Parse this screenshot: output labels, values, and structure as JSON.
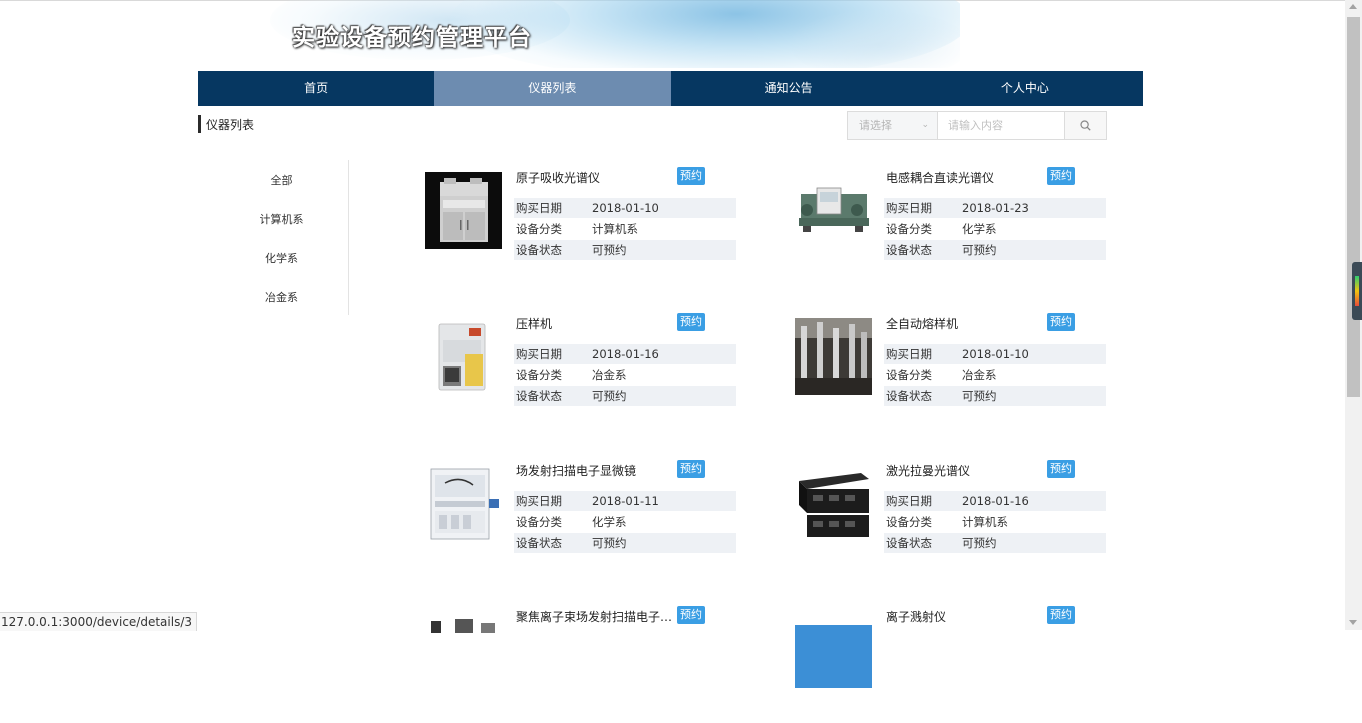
{
  "site_title": "实验设备预约管理平台",
  "nav": [
    {
      "label": "首页",
      "active": false
    },
    {
      "label": "仪器列表",
      "active": true
    },
    {
      "label": "通知公告",
      "active": false
    },
    {
      "label": "个人中心",
      "active": false
    }
  ],
  "section_title": "仪器列表",
  "search": {
    "select_placeholder": "请选择",
    "input_placeholder": "请输入内容"
  },
  "categories": [
    "全部",
    "计算机系",
    "化学系",
    "冶金系"
  ],
  "field_labels": {
    "purchase_date": "购买日期",
    "category": "设备分类",
    "status": "设备状态"
  },
  "book_label": "预约",
  "devices": [
    {
      "name": "原子吸收光谱仪",
      "purchase_date": "2018-01-10",
      "category": "计算机系",
      "status": "可预约"
    },
    {
      "name": "电感耦合直读光谱仪",
      "purchase_date": "2018-01-23",
      "category": "化学系",
      "status": "可预约"
    },
    {
      "name": "压样机",
      "purchase_date": "2018-01-16",
      "category": "冶金系",
      "status": "可预约"
    },
    {
      "name": "全自动熔样机",
      "purchase_date": "2018-01-10",
      "category": "冶金系",
      "status": "可预约"
    },
    {
      "name": "场发射扫描电子显微镜",
      "purchase_date": "2018-01-11",
      "category": "化学系",
      "status": "可预约"
    },
    {
      "name": "激光拉曼光谱仪",
      "purchase_date": "2018-01-16",
      "category": "计算机系",
      "status": "可预约"
    },
    {
      "name": "聚焦离子束场发射扫描电子显微镜",
      "purchase_date": "",
      "category": "",
      "status": ""
    },
    {
      "name": "离子溅射仪",
      "purchase_date": "",
      "category": "",
      "status": ""
    }
  ],
  "status_url": "127.0.0.1:3000/device/details/3",
  "colors": {
    "nav_bg": "#063761",
    "nav_active": "#6d8cb0",
    "book_button": "#3a9ee4",
    "row_shade": "#eef1f5"
  }
}
